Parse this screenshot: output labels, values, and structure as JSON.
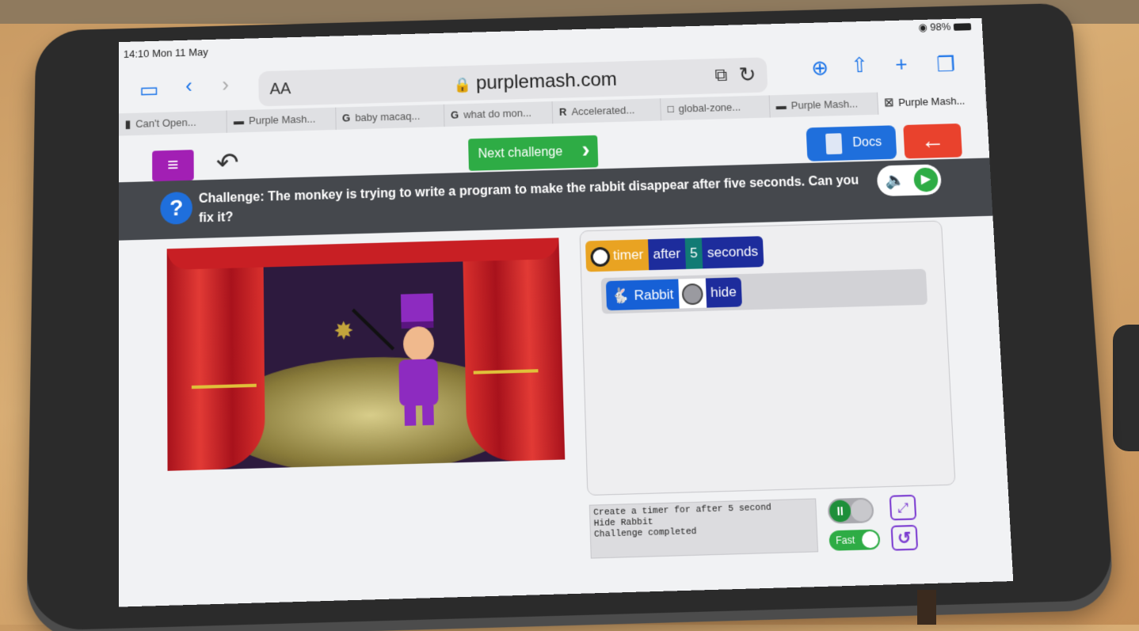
{
  "status": {
    "time": "14:10  Mon 11 May",
    "battery": "98%"
  },
  "browser": {
    "text_size": "AA",
    "url": "purplemash.com",
    "tabs": [
      {
        "favicon": "▮",
        "label": "Can't Open..."
      },
      {
        "favicon": "▬",
        "label": "Purple Mash..."
      },
      {
        "favicon": "G",
        "label": "baby macaq..."
      },
      {
        "favicon": "G",
        "label": "what do mon..."
      },
      {
        "favicon": "R",
        "label": "Accelerated..."
      },
      {
        "favicon": "□",
        "label": "global-zone..."
      },
      {
        "favicon": "▬",
        "label": "Purple Mash..."
      },
      {
        "favicon": "☒",
        "label": "Purple Mash..."
      }
    ]
  },
  "app": {
    "next_label": "Next challenge",
    "docs_label": "Docs",
    "challenge": "Challenge: The monkey is trying to write a program to make the rabbit disappear after five seconds. Can you fix it?"
  },
  "code": {
    "timer_block": {
      "keyword": "timer",
      "after": "after",
      "value": "5",
      "unit": "seconds"
    },
    "action_block": {
      "object": "Rabbit",
      "action": "hide"
    }
  },
  "output": {
    "lines": [
      "Create a timer for after 5 second",
      "Hide Rabbit",
      "Challenge completed"
    ]
  },
  "controls": {
    "fast_label": "Fast"
  },
  "icons": {
    "sidebar": "sidebar-icon",
    "back": "chevron-left-icon",
    "forward": "chevron-right-icon",
    "download": "download-icon",
    "share": "share-icon",
    "new_tab": "plus-icon",
    "tabs": "tabs-icon"
  },
  "colors": {
    "purple": "#a21fb4",
    "green": "#2eac45",
    "blue": "#1f6fdc",
    "red": "#e9422d"
  }
}
